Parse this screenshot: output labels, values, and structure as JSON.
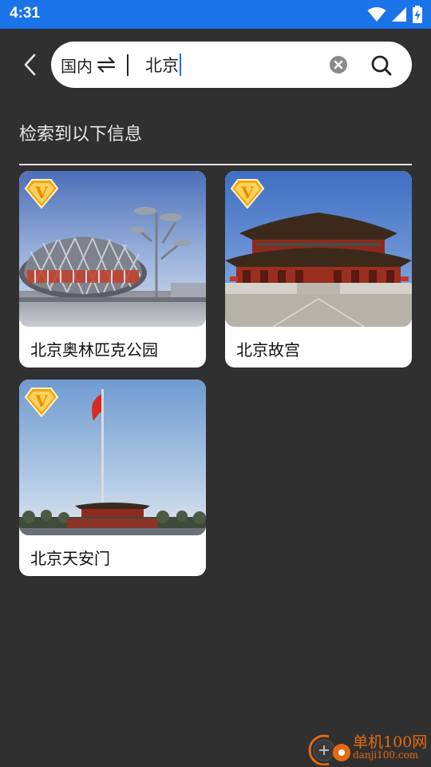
{
  "status_bar": {
    "time": "4:31",
    "icons": [
      "wifi-icon",
      "signal-icon",
      "battery-charging-icon"
    ]
  },
  "header": {
    "back_icon": "chevron-left-icon",
    "search": {
      "region_label": "国内",
      "region_icon": "swap-icon",
      "value": "北京",
      "clear_icon": "clear-icon",
      "search_icon": "search-icon"
    }
  },
  "results": {
    "title": "检索到以下信息",
    "items": [
      {
        "label": "北京奥林匹克公园",
        "badge": "V",
        "badge_icon": "vip-badge-icon"
      },
      {
        "label": "北京故宫",
        "badge": "V",
        "badge_icon": "vip-badge-icon"
      },
      {
        "label": "北京天安门",
        "badge": "V",
        "badge_icon": "vip-badge-icon"
      }
    ]
  },
  "watermark": {
    "name": "单机100网",
    "url": "danji100.com"
  },
  "colors": {
    "status_bar": "#1a73e8",
    "background": "#313031",
    "badge": "#f3a413",
    "watermark": "#e26b11"
  }
}
